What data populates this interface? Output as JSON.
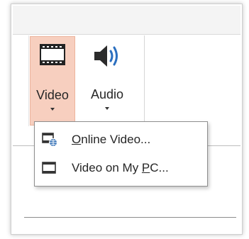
{
  "ribbon": {
    "video_button": {
      "label": "Video",
      "icon": "film-strip-icon",
      "state": "pressed",
      "highlight": "#f7cfbf"
    },
    "audio_button": {
      "label": "Audio",
      "icon": "speaker-icon"
    }
  },
  "video_menu": {
    "items": [
      {
        "prefix": "",
        "mnemonic": "O",
        "rest": "nline Video...",
        "icon": "online-video-icon"
      },
      {
        "prefix": "Video on My ",
        "mnemonic": "P",
        "rest": "C...",
        "icon": "film-strip-icon"
      }
    ]
  }
}
